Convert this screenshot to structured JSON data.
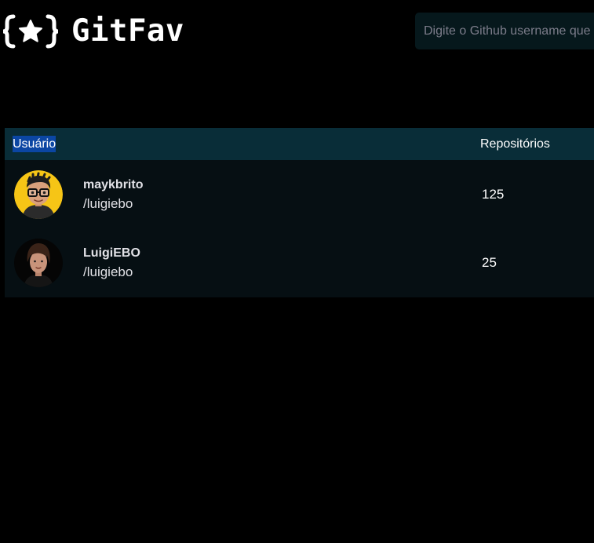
{
  "header": {
    "logo_text": "GitFav",
    "logo_icon": "star-braces-icon"
  },
  "search": {
    "placeholder": "Digite o Github username que",
    "value": ""
  },
  "table": {
    "columns": {
      "user": "Usuário",
      "repositories": "Repositórios"
    },
    "rows": [
      {
        "name": "maykbrito",
        "login": "/luigiebo",
        "repositories": "125"
      },
      {
        "name": "LuigiEBO",
        "login": "/luigiebo",
        "repositories": "25"
      }
    ]
  },
  "colors": {
    "background": "#000000",
    "table_header": "#092d38",
    "row": "#060f13",
    "search_bg": "#06181c",
    "selection": "#0b46a3"
  }
}
